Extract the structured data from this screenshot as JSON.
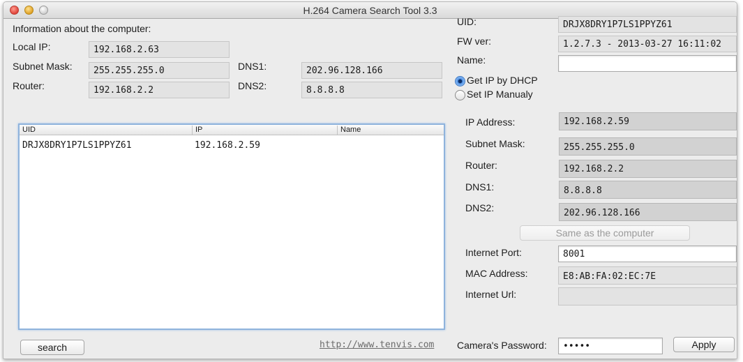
{
  "window": {
    "title": "H.264 Camera Search Tool 3.3"
  },
  "computer": {
    "heading": "Information about the computer:",
    "local_ip_label": "Local IP:",
    "local_ip": "192.168.2.63",
    "subnet_label": "Subnet Mask:",
    "subnet": "255.255.255.0",
    "dns1_label": "DNS1:",
    "dns1": "202.96.128.166",
    "router_label": "Router:",
    "router": "192.168.2.2",
    "dns2_label": "DNS2:",
    "dns2": "8.8.8.8"
  },
  "device_list": {
    "columns": [
      "UID",
      "IP",
      "Name"
    ],
    "rows": [
      {
        "uid": "DRJX8DRY1P7LS1PPYZ61",
        "ip": "192.168.2.59",
        "name": ""
      }
    ]
  },
  "camera": {
    "uid_label": "UID:",
    "uid": "DRJX8DRY1P7LS1PPYZ61",
    "fw_label": "FW ver:",
    "fw": "1.2.7.3 - 2013-03-27 16:11:02",
    "name_label": "Name:",
    "name": "",
    "dhcp_label": "Get IP by DHCP",
    "dhcp_selected": true,
    "manual_label": "Set IP Manualy",
    "ip_label": "IP Address:",
    "ip": "192.168.2.59",
    "subnet_label": "Subnet Mask:",
    "subnet": "255.255.255.0",
    "router_label": "Router:",
    "router": "192.168.2.2",
    "dns1_label": "DNS1:",
    "dns1": "8.8.8.8",
    "dns2_label": "DNS2:",
    "dns2": "202.96.128.166",
    "same_button": "Same as the computer",
    "port_label": "Internet Port:",
    "port": "8001",
    "mac_label": "MAC Address:",
    "mac": "E8:AB:FA:02:EC:7E",
    "url_label": "Internet Url:",
    "url": "",
    "password_label": "Camera's Password:",
    "password": "•••••"
  },
  "footer": {
    "search_button": "search",
    "link": "http://www.tenvis.com",
    "apply_button": "Apply"
  }
}
